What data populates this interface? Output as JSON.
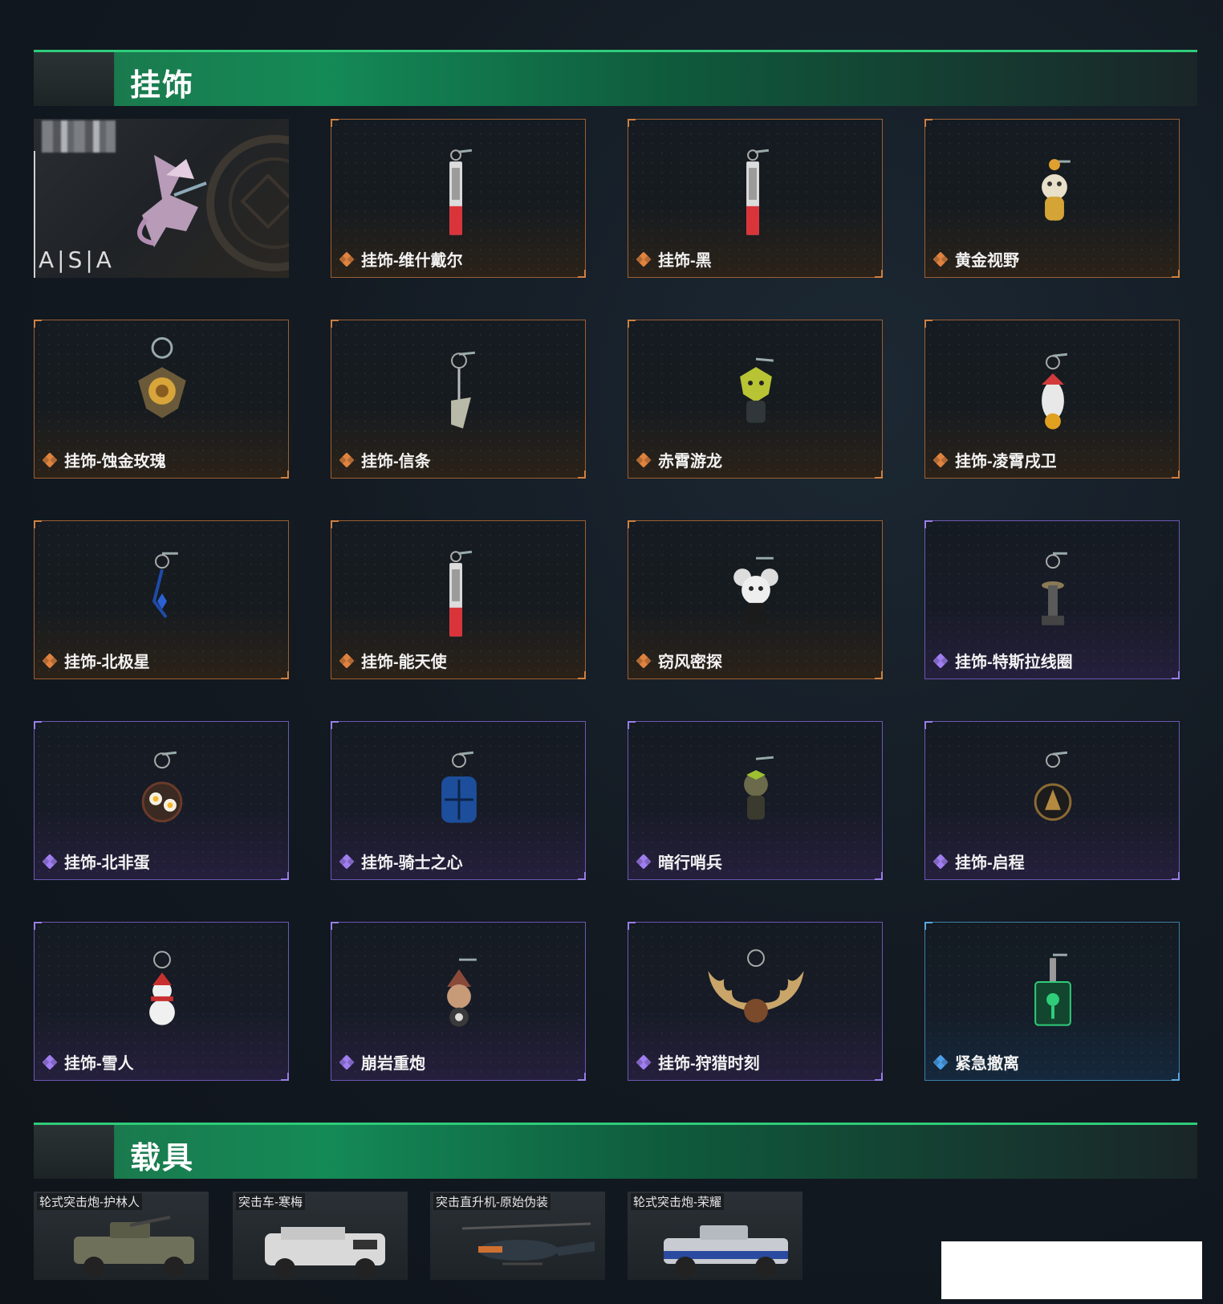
{
  "sections": {
    "charms": {
      "title": "挂饰"
    },
    "vehicles": {
      "title": "载具"
    }
  },
  "featured": {
    "logo_text": "A|S|A"
  },
  "charms": [
    {
      "name": "挂饰-维什戴尔",
      "rarity": "orange",
      "icon": "charm-tag-red"
    },
    {
      "name": "挂饰-黑",
      "rarity": "orange",
      "icon": "charm-tag-red"
    },
    {
      "name": "黄金视野",
      "rarity": "orange",
      "icon": "charm-figure-bear"
    },
    {
      "name": "挂饰-蚀金玫瑰",
      "rarity": "orange",
      "icon": "charm-rose-ring"
    },
    {
      "name": "挂饰-信条",
      "rarity": "orange",
      "icon": "charm-knife"
    },
    {
      "name": "赤霄游龙",
      "rarity": "orange",
      "icon": "charm-dragon-figure"
    },
    {
      "name": "挂饰-凌霄戌卫",
      "rarity": "orange",
      "icon": "charm-dog-figure"
    },
    {
      "name": "挂饰-北极星",
      "rarity": "orange",
      "icon": "charm-star-blue"
    },
    {
      "name": "挂饰-能天使",
      "rarity": "orange",
      "icon": "charm-tag-red"
    },
    {
      "name": "窃风密探",
      "rarity": "orange",
      "icon": "charm-mouse-figure"
    },
    {
      "name": "挂饰-特斯拉线圈",
      "rarity": "purple",
      "icon": "charm-tesla-coil"
    },
    {
      "name": "挂饰-北非蛋",
      "rarity": "purple",
      "icon": "charm-egg-pan"
    },
    {
      "name": "挂饰-骑士之心",
      "rarity": "purple",
      "icon": "charm-shield-blue"
    },
    {
      "name": "暗行哨兵",
      "rarity": "purple",
      "icon": "charm-soldier-figure"
    },
    {
      "name": "挂饰-启程",
      "rarity": "purple",
      "icon": "charm-medal"
    },
    {
      "name": "挂饰-雪人",
      "rarity": "purple",
      "icon": "charm-snowman"
    },
    {
      "name": "崩岩重炮",
      "rarity": "purple",
      "icon": "charm-gnome-figure"
    },
    {
      "name": "挂饰-狩猎时刻",
      "rarity": "purple",
      "icon": "charm-antlers"
    },
    {
      "name": "紧急撤离",
      "rarity": "blue",
      "icon": "charm-green-sign"
    }
  ],
  "vehicles": [
    {
      "name": "轮式突击炮-护林人",
      "icon": "armored-car-camo"
    },
    {
      "name": "突击车-寒梅",
      "icon": "armored-car-white"
    },
    {
      "name": "突击直升机-原始伪装",
      "icon": "attack-helicopter"
    },
    {
      "name": "轮式突击炮-荣耀",
      "icon": "armored-car-blue"
    }
  ],
  "colors": {
    "orange": "#e0833f",
    "purple": "#a07ef0",
    "blue": "#4aa0e8",
    "accent_green": "#2fcc7a"
  }
}
